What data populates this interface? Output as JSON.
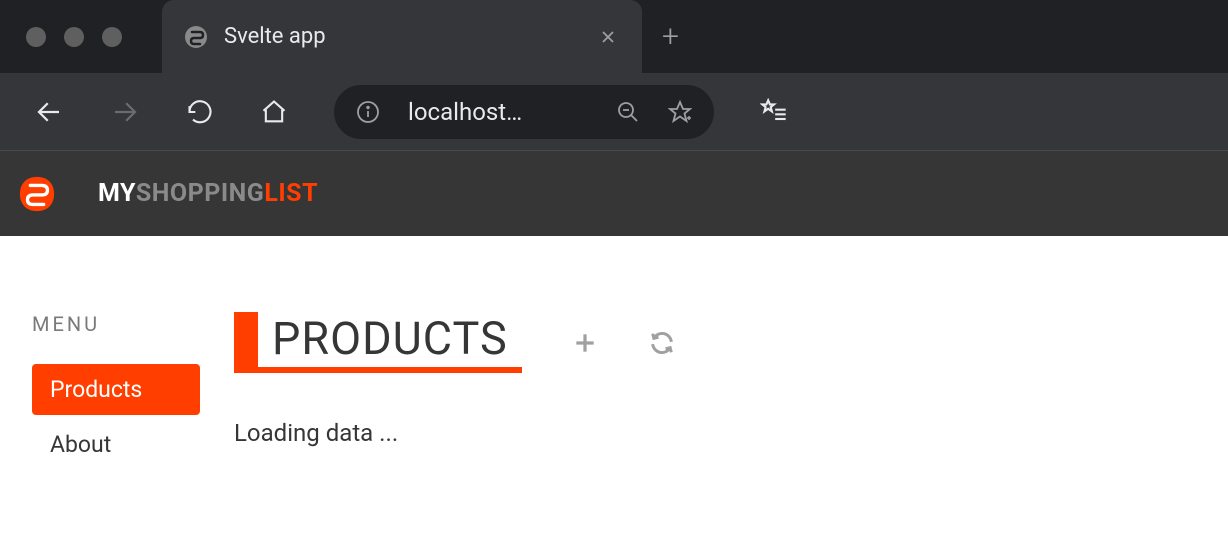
{
  "browser": {
    "tab_title": "Svelte app",
    "address": "localhost…"
  },
  "app": {
    "brand_my": "MY",
    "brand_shopping": "SHOPPING",
    "brand_list": "LIST"
  },
  "sidebar": {
    "heading": "MENU",
    "items": [
      {
        "label": "Products",
        "active": true
      },
      {
        "label": "About",
        "active": false
      }
    ]
  },
  "main": {
    "title": "PRODUCTS",
    "loading_text": "Loading data ..."
  },
  "colors": {
    "accent": "#ff3e00",
    "dark": "#363636"
  }
}
